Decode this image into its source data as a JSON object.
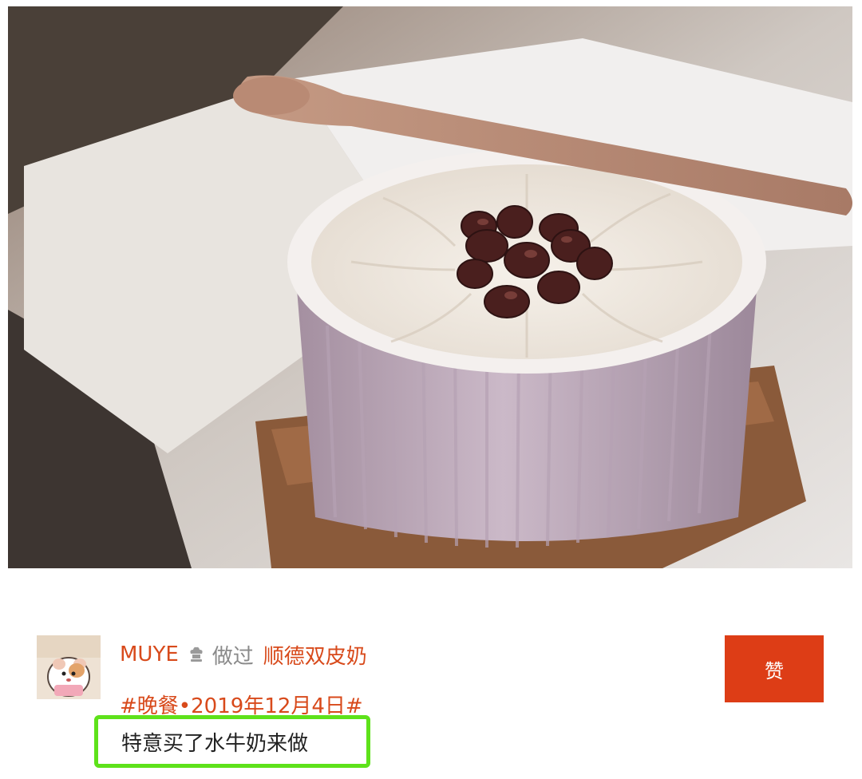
{
  "photo": {
    "subject": "double-skin milk dessert with red beans and wooden spoon"
  },
  "post": {
    "username": "MUYE",
    "did_label": "做过",
    "recipe_name": "顺德双皮奶",
    "tag": "#晚餐•2019年12月4日#",
    "comment": "特意买了水牛奶来做"
  },
  "actions": {
    "like_label": "赞"
  },
  "icons": {
    "chef": "chef-hat-icon"
  },
  "colors": {
    "accent": "#d84a1b",
    "like_button": "#dd3d16",
    "highlight": "#5ee21a"
  }
}
